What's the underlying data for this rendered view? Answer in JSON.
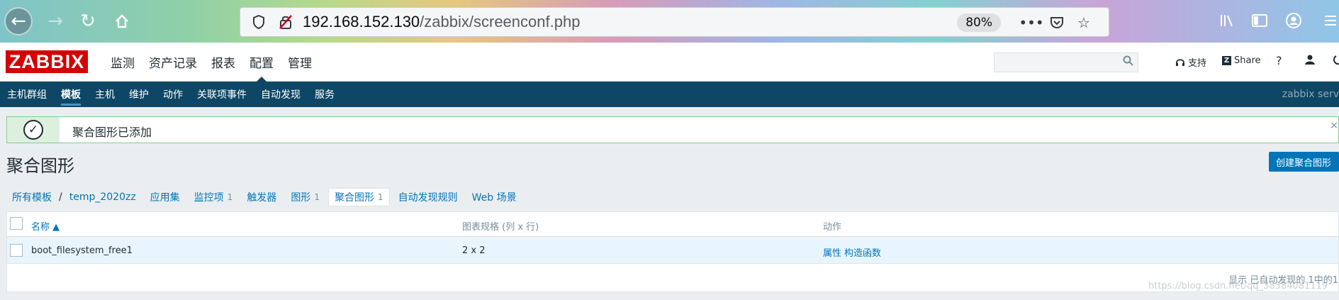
{
  "browser": {
    "url_host": "192.168.152.130",
    "url_path": "/zabbix/screenconf.php",
    "zoom": "80%"
  },
  "header": {
    "logo": "ZABBIX",
    "menu": [
      {
        "label": "监测"
      },
      {
        "label": "资产记录"
      },
      {
        "label": "报表"
      },
      {
        "label": "配置"
      },
      {
        "label": "管理"
      }
    ],
    "support": "支持",
    "share": "Share",
    "help": "?"
  },
  "submenu": {
    "items": [
      {
        "label": "主机群组"
      },
      {
        "label": "模板"
      },
      {
        "label": "主机"
      },
      {
        "label": "维护"
      },
      {
        "label": "动作"
      },
      {
        "label": "关联项事件"
      },
      {
        "label": "自动发现"
      },
      {
        "label": "服务"
      }
    ],
    "server": "zabbix serv"
  },
  "message": {
    "text": "聚合图形已添加"
  },
  "page": {
    "title": "聚合图形",
    "create_button": "创建聚合图形"
  },
  "crumbs": {
    "all_templates": "所有模板",
    "separator": "/",
    "template": "temp_2020zz",
    "apps": "应用集",
    "items": "监控项",
    "items_count": "1",
    "triggers": "触发器",
    "graphs": "图形",
    "graphs_count": "1",
    "screens": "聚合图形",
    "screens_count": "1",
    "discovery": "自动发现规则",
    "web": "Web 场景"
  },
  "table": {
    "col_name": "名称 ▲",
    "col_size": "图表规格 (列 x 行)",
    "col_actions": "动作",
    "rows": [
      {
        "name": "boot_filesystem_free1",
        "size": "2 x 2",
        "action_props": "属性",
        "action_constructor": "构造函数"
      }
    ],
    "footer": "显示 已自动发现的 1中的1"
  },
  "watermark": "https://blog.csdn.net/qq_38384081119"
}
